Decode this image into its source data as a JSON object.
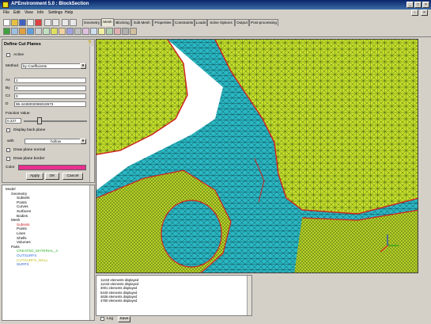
{
  "window": {
    "title": "AI*Environment 5.0 : BlockSection"
  },
  "menu": [
    "File",
    "Edit",
    "View",
    "Info",
    "Settings",
    "Help"
  ],
  "tabs": [
    {
      "label": "Geometry"
    },
    {
      "label": "Mesh"
    },
    {
      "label": "Blocking"
    },
    {
      "label": "Edit Mesh"
    },
    {
      "label": "Properties"
    },
    {
      "label": "Constraints"
    },
    {
      "label": "Loads"
    },
    {
      "label": "Solve Options"
    },
    {
      "label": "Output"
    },
    {
      "label": "Post-processing"
    }
  ],
  "active_tab": "Mesh",
  "panel": {
    "title": "Define Cut Planes",
    "active_label": "Active",
    "method_label": "Method",
    "method_value": "by Coefficients",
    "ax_label": "Ax",
    "ax_value": "1",
    "by_label": "By",
    "by_value": "0",
    "cz_label": "Cz",
    "cz_value": "0",
    "d_label": "D",
    "d_value": "96.4445002069319573",
    "fraction_label": "Fraction Value",
    "fraction_value": "0.237",
    "display_back_label": "Display back plane",
    "with_label": "with",
    "with_value": "hollow",
    "draw_normal_label": "Draw plane normal",
    "draw_border_label": "Draw plane border",
    "color_label": "Color",
    "color_value": "#e8308f",
    "apply": "Apply",
    "ok": "OK",
    "cancel": "Cancel"
  },
  "tree": [
    {
      "label": "Model",
      "indent": 0,
      "color": "#000000"
    },
    {
      "label": "Geometry",
      "indent": 1,
      "color": "#000000"
    },
    {
      "label": "Subsets",
      "indent": 2,
      "color": "#000000"
    },
    {
      "label": "Points",
      "indent": 2,
      "color": "#000000"
    },
    {
      "label": "Curves",
      "indent": 2,
      "color": "#000000"
    },
    {
      "label": "Surfaces",
      "indent": 2,
      "color": "#000000"
    },
    {
      "label": "Bodies",
      "indent": 2,
      "color": "#000000"
    },
    {
      "label": "Mesh",
      "indent": 1,
      "color": "#000000"
    },
    {
      "label": "Subsets",
      "indent": 2,
      "color": "#cc2020"
    },
    {
      "label": "Points",
      "indent": 2,
      "color": "#000000"
    },
    {
      "label": "Lines",
      "indent": 2,
      "color": "#000000"
    },
    {
      "label": "Shells",
      "indent": 2,
      "color": "#000000"
    },
    {
      "label": "Volumes",
      "indent": 2,
      "color": "#000000"
    },
    {
      "label": "Parts",
      "indent": 1,
      "color": "#000000"
    },
    {
      "label": "CREATED_MATERIAL_4",
      "indent": 2,
      "color": "#30b030"
    },
    {
      "label": "OUTSURFS",
      "indent": 2,
      "color": "#3070e0"
    },
    {
      "label": "CUTSURFS_WALL",
      "indent": 2,
      "color": "#c0c020"
    },
    {
      "label": "SURFS",
      "indent": 2,
      "color": "#3060c0"
    }
  ],
  "console": [
    "11443 elements displayed",
    "11443 elements displayed",
    "3001 elements displayed",
    "5440 elements displayed",
    "4636 elements displayed",
    "4760 elements displayed"
  ],
  "console_tabs": {
    "log": "Log",
    "save": "Save"
  },
  "help_icon": "?",
  "colors": {
    "mesh_yellow": "#c8e02a",
    "mesh_teal": "#2ab8c4",
    "outline_red": "#d02020"
  }
}
